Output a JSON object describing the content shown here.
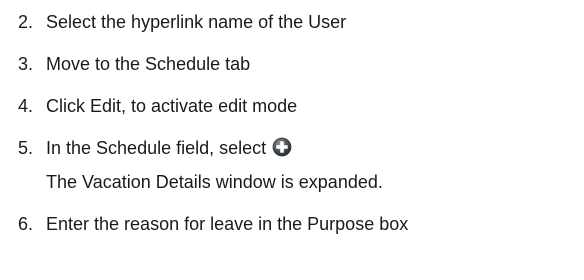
{
  "steps": [
    {
      "num": "2.",
      "text": "Select the hyperlink name of the User"
    },
    {
      "num": "3.",
      "text": "Move to the Schedule tab"
    },
    {
      "num": "4.",
      "text": "Click Edit, to activate edit mode"
    },
    {
      "num": "5.",
      "text": "In the Schedule field, select",
      "icon": "plus-circle-icon"
    },
    {
      "note": "The Vacation Details window is expanded."
    },
    {
      "num": "6.",
      "text": "Enter the reason for leave in the Purpose box"
    }
  ]
}
